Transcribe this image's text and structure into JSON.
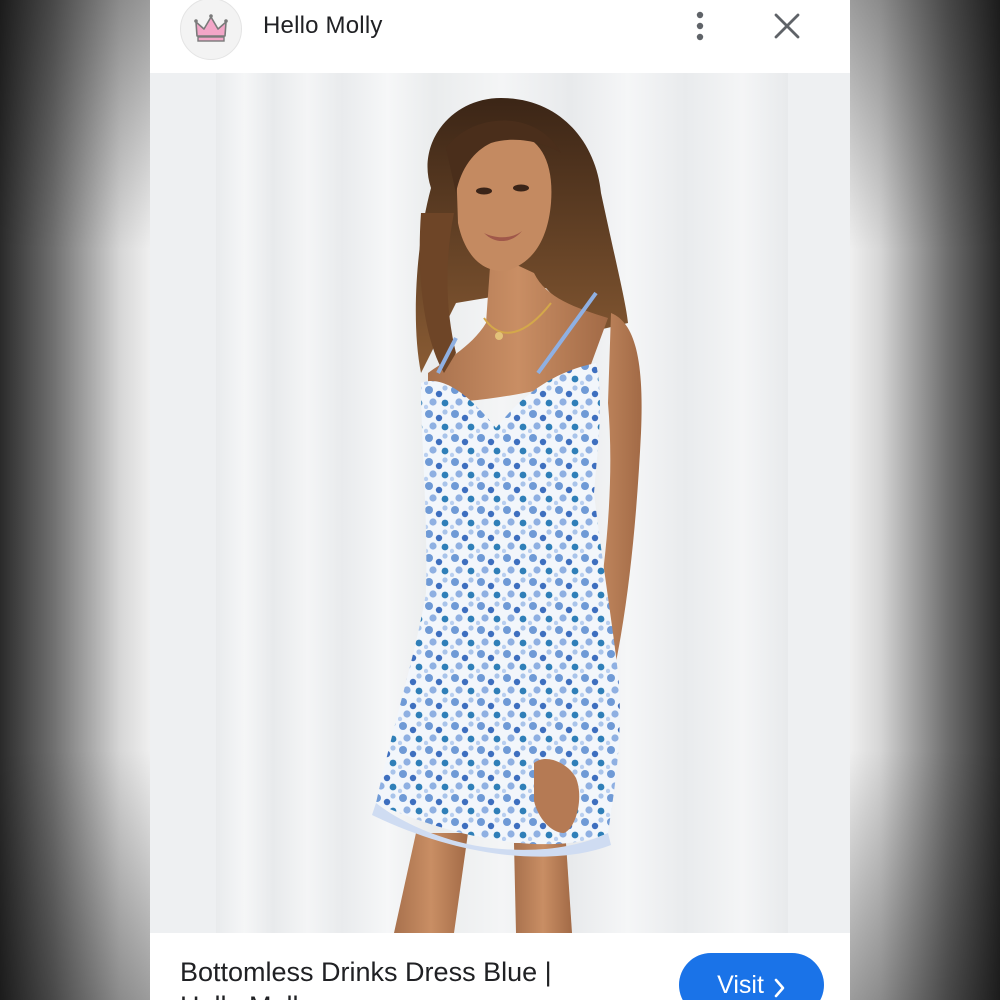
{
  "header": {
    "site_name": "Hello Molly",
    "logo_icon": "crown-icon",
    "more_icon": "more-vert-icon",
    "close_icon": "close-icon"
  },
  "image": {
    "alt": "Model wearing blue floral ruched mini dress"
  },
  "footer": {
    "title": "Bottomless Drinks Dress Blue | Hello Molly",
    "visit_label": "Visit",
    "visit_icon": "chevron-right-icon"
  },
  "colors": {
    "accent": "#1a73e8",
    "text": "#202124",
    "icon": "#5f6368",
    "crown": "#f3a6c8"
  }
}
